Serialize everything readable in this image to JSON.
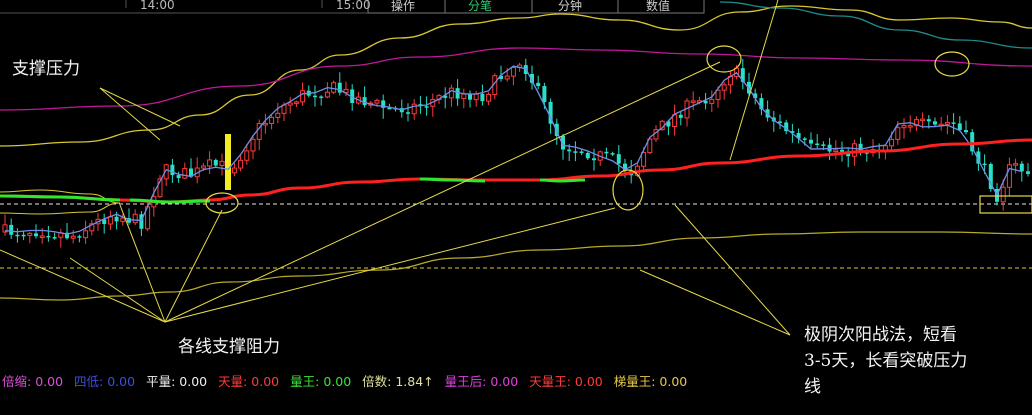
{
  "header": {
    "time_marks": [
      "14:00",
      "15:00"
    ],
    "tabs": [
      {
        "label": "操作",
        "active": false
      },
      {
        "label": "分笔",
        "active": true
      },
      {
        "label": "分钟",
        "active": false
      },
      {
        "label": "数值",
        "active": false
      }
    ]
  },
  "annotations": {
    "support_pressure": "支撑压力",
    "lines_support": "各线支撑阻力",
    "strategy_line1": "极阴次阳战法，短看",
    "strategy_line2": "3-5天，长看突破压力",
    "strategy_line3": "线"
  },
  "stats_bar": [
    {
      "label": "倍缩:",
      "value": "0.00",
      "color": "#d94fd9"
    },
    {
      "label": "四低:",
      "value": "0.00",
      "color": "#3b4fe0"
    },
    {
      "label": "平量:",
      "value": "0.00",
      "color": "#f0f0f0"
    },
    {
      "label": "天量:",
      "value": "0.00",
      "color": "#ff3b3b"
    },
    {
      "label": "量王:",
      "value": "0.00",
      "color": "#39e639"
    },
    {
      "label": "倍数:",
      "value": "1.84↑",
      "color": "#e0e0a0"
    },
    {
      "label": "量王后:",
      "value": "0.00",
      "color": "#e040e0"
    },
    {
      "label": "天量王:",
      "value": "0.00",
      "color": "#ff3b3b"
    },
    {
      "label": "梯量王:",
      "value": "0.00",
      "color": "#e8c84a"
    }
  ],
  "colors": {
    "background": "#000000",
    "up_candle": "#ff3b3b",
    "down_candle": "#27e0c7",
    "ma_line": "#6f8fe8",
    "support_line": "#ff2020",
    "support_line_green": "#2ee82e",
    "boll_band": "#d8c830",
    "upper_line": "#c0189a",
    "teal_line": "#1f8b8b",
    "annotation_lines": "#e6d94a"
  }
}
